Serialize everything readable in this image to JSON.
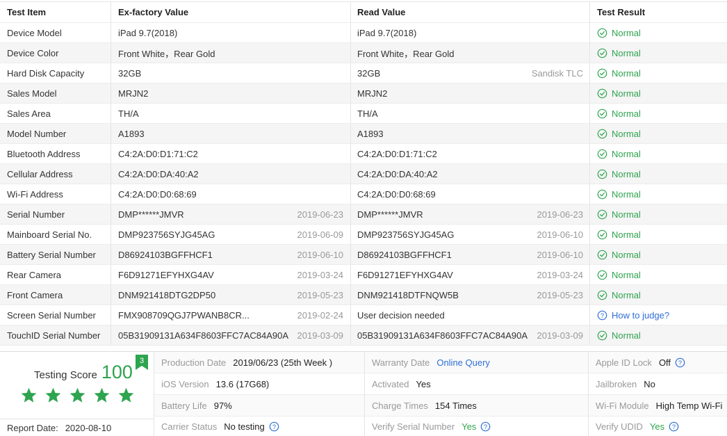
{
  "columns": [
    "Test Item",
    "Ex-factory Value",
    "Read Value",
    "Test Result"
  ],
  "rows": [
    {
      "item": "Device Model",
      "ex": "iPad 9.7(2018)",
      "ex_aux": "",
      "read": "iPad 9.7(2018)",
      "read_aux": "",
      "result": "Normal",
      "status": "ok"
    },
    {
      "item": "Device Color",
      "ex": "Front White，Rear Gold",
      "ex_aux": "",
      "read": "Front White，Rear Gold",
      "read_aux": "",
      "result": "Normal",
      "status": "ok"
    },
    {
      "item": "Hard Disk Capacity",
      "ex": "32GB",
      "ex_aux": "",
      "read": "32GB",
      "read_aux": "Sandisk TLC",
      "result": "Normal",
      "status": "ok"
    },
    {
      "item": "Sales Model",
      "ex": "MRJN2",
      "ex_aux": "",
      "read": "MRJN2",
      "read_aux": "",
      "result": "Normal",
      "status": "ok"
    },
    {
      "item": "Sales Area",
      "ex": "TH/A",
      "ex_aux": "",
      "read": "TH/A",
      "read_aux": "",
      "result": "Normal",
      "status": "ok"
    },
    {
      "item": "Model Number",
      "ex": "A1893",
      "ex_aux": "",
      "read": "A1893",
      "read_aux": "",
      "result": "Normal",
      "status": "ok"
    },
    {
      "item": "Bluetooth Address",
      "ex": "C4:2A:D0:D1:71:C2",
      "ex_aux": "",
      "read": "C4:2A:D0:D1:71:C2",
      "read_aux": "",
      "result": "Normal",
      "status": "ok"
    },
    {
      "item": "Cellular Address",
      "ex": "C4:2A:D0:DA:40:A2",
      "ex_aux": "",
      "read": "C4:2A:D0:DA:40:A2",
      "read_aux": "",
      "result": "Normal",
      "status": "ok"
    },
    {
      "item": "Wi-Fi Address",
      "ex": "C4:2A:D0:D0:68:69",
      "ex_aux": "",
      "read": "C4:2A:D0:D0:68:69",
      "read_aux": "",
      "result": "Normal",
      "status": "ok"
    },
    {
      "item": "Serial Number",
      "ex": "DMP******JMVR",
      "ex_aux": "2019-06-23",
      "read": "DMP******JMVR",
      "read_aux": "2019-06-23",
      "result": "Normal",
      "status": "ok"
    },
    {
      "item": "Mainboard Serial No.",
      "ex": "DMP923756SYJG45AG",
      "ex_aux": "2019-06-09",
      "read": "DMP923756SYJG45AG",
      "read_aux": "2019-06-10",
      "result": "Normal",
      "status": "ok"
    },
    {
      "item": "Battery Serial Number",
      "ex": "D86924103BGFFHCF1",
      "ex_aux": "2019-06-10",
      "read": "D86924103BGFFHCF1",
      "read_aux": "2019-06-10",
      "result": "Normal",
      "status": "ok"
    },
    {
      "item": "Rear Camera",
      "ex": "F6D91271EFYHXG4AV",
      "ex_aux": "2019-03-24",
      "read": "F6D91271EFYHXG4AV",
      "read_aux": "2019-03-24",
      "result": "Normal",
      "status": "ok"
    },
    {
      "item": "Front Camera",
      "ex": "DNM921418DTG2DP50",
      "ex_aux": "2019-05-23",
      "read": "DNM921418DTFNQW5B",
      "read_aux": "2019-05-23",
      "result": "Normal",
      "status": "ok"
    },
    {
      "item": "Screen Serial Number",
      "ex": "FMX908709QGJ7PWANB8CR...",
      "ex_aux": "2019-02-24",
      "read": "User decision needed",
      "read_aux": "",
      "result": "How to judge?",
      "status": "help"
    },
    {
      "item": "TouchID Serial Number",
      "ex": "05B31909131A634F8603FFC7AC84A90A",
      "ex_aux": "2019-03-09",
      "read": "05B31909131A634F8603FFC7AC84A90A",
      "read_aux": "2019-03-09",
      "result": "Normal",
      "status": "ok"
    }
  ],
  "score": {
    "label": "Testing Score",
    "value": "100",
    "badge": "3",
    "stars": 5,
    "report_date_label": "Report Date:",
    "report_date": "2020-08-10"
  },
  "summary": [
    [
      {
        "label": "Production Date",
        "value": "2019/06/23 (25th Week )",
        "style": "",
        "help": false
      },
      {
        "label": "Warranty Date",
        "value": "Online Query",
        "style": "blue",
        "help": false
      },
      {
        "label": "Apple ID Lock",
        "value": "Off",
        "style": "",
        "help": true
      }
    ],
    [
      {
        "label": "iOS Version",
        "value": "13.6 (17G68)",
        "style": "",
        "help": false
      },
      {
        "label": "Activated",
        "value": "Yes",
        "style": "",
        "help": false
      },
      {
        "label": "Jailbroken",
        "value": "No",
        "style": "",
        "help": false
      }
    ],
    [
      {
        "label": "Battery Life",
        "value": "97%",
        "style": "",
        "help": false
      },
      {
        "label": "Charge Times",
        "value": "154 Times",
        "style": "",
        "help": false
      },
      {
        "label": "Wi-Fi Module",
        "value": "High Temp Wi-Fi",
        "style": "",
        "help": false
      }
    ],
    [
      {
        "label": "Carrier Status",
        "value": "No testing",
        "style": "",
        "help": true
      },
      {
        "label": "Verify Serial Number",
        "value": "Yes",
        "style": "green",
        "help": true
      },
      {
        "label": "Verify UDID",
        "value": "Yes",
        "style": "green",
        "help": true
      }
    ]
  ],
  "colors": {
    "ok": "#2ea44f",
    "link": "#2f6fd6",
    "muted": "#999999"
  }
}
